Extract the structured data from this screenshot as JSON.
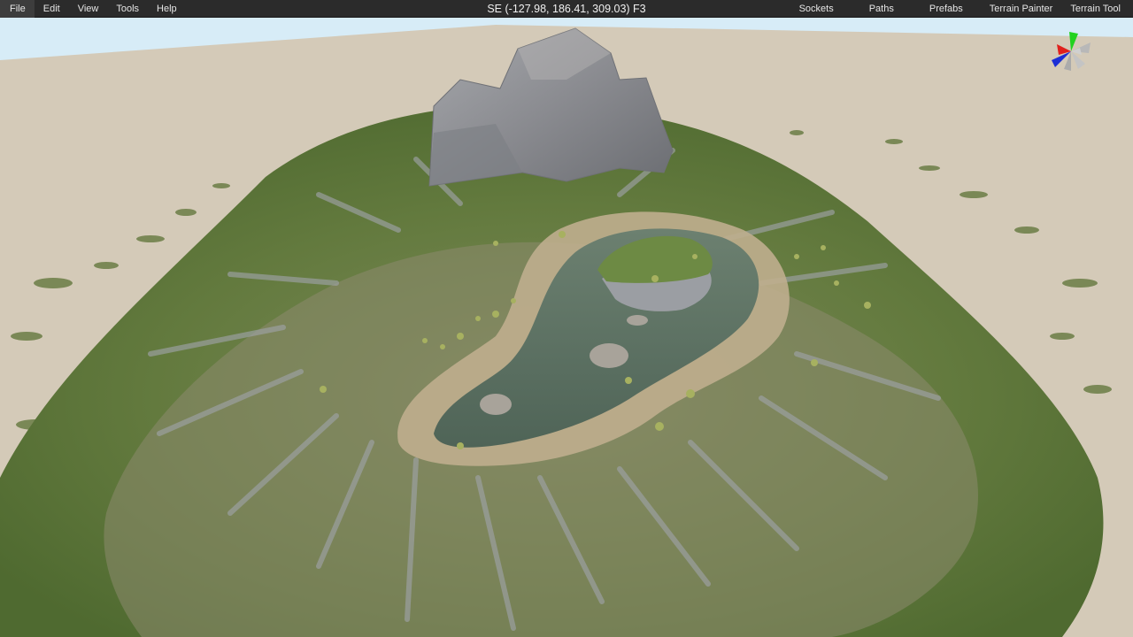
{
  "menubar": {
    "left_items": [
      "File",
      "Edit",
      "View",
      "Tools",
      "Help"
    ],
    "right_items": [
      "Sockets",
      "Paths",
      "Prefabs",
      "Terrain Painter",
      "Terrain Tool"
    ],
    "status": "SE (-127.98, 186.41, 309.03) F3"
  },
  "viewport": {
    "colors": {
      "sky": "#d7ecf7",
      "sand": "#d4cab8",
      "grass": "#5f7a3c",
      "rock": "#8e9196",
      "water": "#5b7060",
      "shore": "#c7b89c"
    }
  },
  "gizmo": {
    "axes": [
      {
        "name": "x",
        "color": "#e0201c"
      },
      {
        "name": "y",
        "color": "#22d21e"
      },
      {
        "name": "z",
        "color": "#1c2fd6"
      }
    ]
  }
}
